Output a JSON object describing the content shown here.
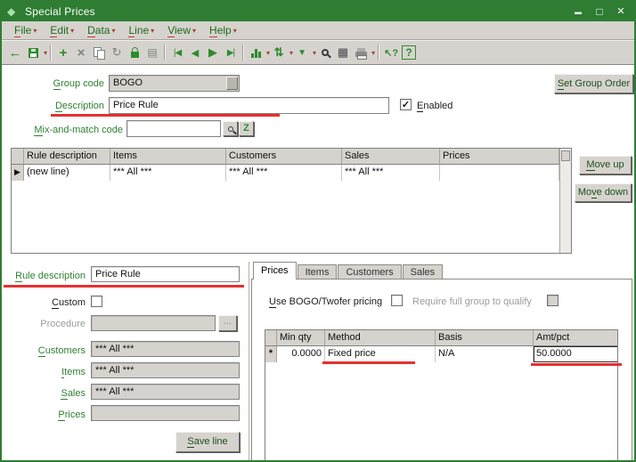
{
  "window": {
    "title": "Special Prices"
  },
  "menu": {
    "items": [
      "File",
      "Edit",
      "Data",
      "Line",
      "View",
      "Help"
    ]
  },
  "toolbar": {
    "icons": [
      "back",
      "save",
      "new-record",
      "delete",
      "copy",
      "refresh",
      "lock",
      "media",
      "first-record",
      "previous-record",
      "next-record",
      "last-record",
      "chart",
      "sort",
      "filter",
      "search",
      "calculator",
      "print",
      "context-help",
      "help"
    ]
  },
  "header": {
    "group_code_label": "Group code",
    "group_code_value": "BOGO",
    "set_group_order_button": "Set Group Order",
    "description_label": "Description",
    "description_value": "Price Rule",
    "enabled_label": "Enabled",
    "enabled_check": "✓",
    "mix_match_label": "Mix-and-match code",
    "mix_match_value": ""
  },
  "rules_grid": {
    "columns": [
      "Rule description",
      "Items",
      "Customers",
      "Sales",
      "Prices"
    ],
    "rows": [
      {
        "selector": "▶",
        "rule_description": "(new line)",
        "items": "*** All ***",
        "customers": "*** All ***",
        "sales": "*** All ***",
        "prices": ""
      }
    ],
    "move_up_button": "Move up",
    "move_down_button": "Move down"
  },
  "detail": {
    "rule_description_label": "Rule description",
    "rule_description_value": "Price Rule",
    "custom_label": "Custom",
    "procedure_label": "Procedure",
    "procedure_value": "",
    "browse_button": "...",
    "customers_label": "Customers",
    "customers_value": "*** All ***",
    "items_label": "Items",
    "items_value": "*** All ***",
    "sales_label": "Sales",
    "sales_value": "*** All ***",
    "prices_label": "Prices",
    "prices_value": "",
    "save_line_button": "Save line"
  },
  "pricing": {
    "tabs": [
      "Prices",
      "Items",
      "Customers",
      "Sales"
    ],
    "active_tab": "Prices",
    "use_bogo_label": "Use BOGO/Twofer pricing",
    "require_full_label": "Require full group to qualify",
    "columns": [
      "Min qty",
      "Method",
      "Basis",
      "Amt/pct"
    ],
    "rows": [
      {
        "selector": "*",
        "min_qty": "0.0000",
        "method": "Fixed price",
        "basis": "N/A",
        "amt_pct": "50.0000"
      }
    ]
  },
  "colors": {
    "title_green": "#2e7d32",
    "label_green": "#2f8032",
    "annotation_red": "#e53030"
  }
}
